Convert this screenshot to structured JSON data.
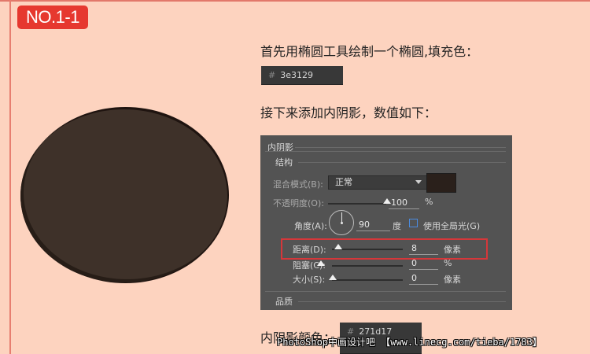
{
  "badge": {
    "label": "NO.1-1"
  },
  "shape": {
    "fill": "#3e3129",
    "inner_shadow": "#271d17"
  },
  "step1": {
    "text": "首先用椭圆工具绘制一个椭圆,填充色：",
    "hash": "#",
    "hex": "3e3129"
  },
  "step2": {
    "text": "接下来添加内阴影，数值如下："
  },
  "panel": {
    "title": "内阴影",
    "structure": "结构",
    "blend_label": "混合模式(B):",
    "blend_value": "正常",
    "opacity_label": "不透明度(O):",
    "opacity_value": "100",
    "opacity_unit": "%",
    "angle_label": "角度(A):",
    "angle_value": "90",
    "angle_unit": "度",
    "global_light_label": "使用全局光(G)",
    "distance_label": "距离(D):",
    "distance_value": "8",
    "distance_unit": "像素",
    "choke_label": "阻塞(C):",
    "choke_value": "0",
    "choke_unit": "%",
    "size_label": "大小(S):",
    "size_value": "0",
    "size_unit": "像素",
    "quality": "品质"
  },
  "step3": {
    "text": "内阴影颜色：",
    "hash": "#",
    "hex": "271d17"
  },
  "watermark": {
    "text": "PhotoShop中画设计吧 【www.linecg.com/tieba/1783】"
  }
}
